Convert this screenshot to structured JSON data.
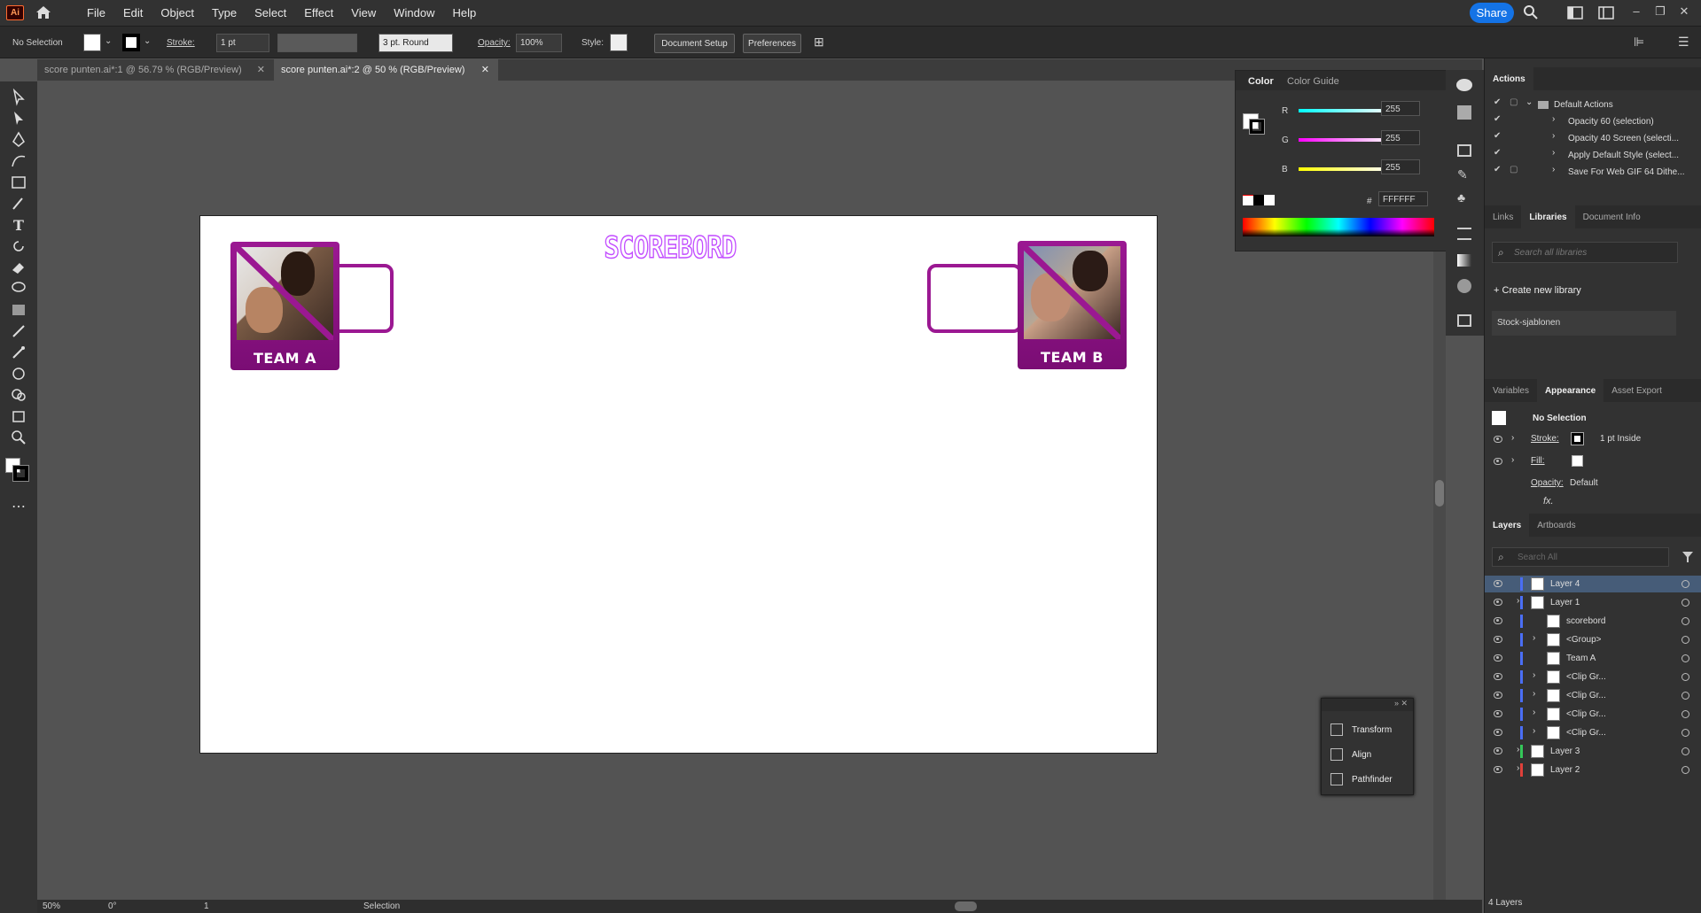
{
  "app": {
    "logo": "Ai",
    "menus": [
      "File",
      "Edit",
      "Object",
      "Type",
      "Select",
      "Effect",
      "View",
      "Window",
      "Help"
    ],
    "share": "Share"
  },
  "control": {
    "selection": "No Selection",
    "stroke_label": "Stroke:",
    "stroke_value": "1 pt",
    "brush": "3 pt. Round",
    "opacity_label": "Opacity:",
    "opacity_value": "100%",
    "style_label": "Style:",
    "doc_setup": "Document Setup",
    "preferences": "Preferences"
  },
  "tabs": [
    {
      "label": "score punten.ai*:1 @ 56.79 % (RGB/Preview)"
    },
    {
      "label": "score punten.ai*:2 @ 50 % (RGB/Preview)"
    }
  ],
  "artboard": {
    "title": "SCOREBORD",
    "team_a": "TEAM A",
    "team_b": "TEAM B"
  },
  "color_panel": {
    "tabs": [
      "Color",
      "Color Guide"
    ],
    "r": "255",
    "g": "255",
    "b": "255",
    "hex": "FFFFFF",
    "r_label": "R",
    "g_label": "G",
    "b_label": "B",
    "hash": "#"
  },
  "actions": {
    "title": "Actions",
    "items": [
      "Default Actions",
      "Opacity 60 (selection)",
      "Opacity 40 Screen (selecti...",
      "Apply Default Style (select...",
      "Save For Web GIF 64 Dithe..."
    ]
  },
  "libraries": {
    "tabs": [
      "Links",
      "Libraries",
      "Document Info"
    ],
    "search_placeholder": "Search all libraries",
    "create": "Create new library",
    "item": "Stock-sjablonen"
  },
  "appearance": {
    "tabs": [
      "Variables",
      "Appearance",
      "Asset Export"
    ],
    "selection": "No Selection",
    "stroke_label": "Stroke:",
    "stroke_value": "1 pt  Inside",
    "fill_label": "Fill:",
    "opacity_label": "Opacity:",
    "opacity_value": "Default",
    "fx": "fx."
  },
  "layers": {
    "tabs": [
      "Layers",
      "Artboards"
    ],
    "search_placeholder": "Search All",
    "footer": "4 Layers",
    "rows": [
      {
        "name": "Layer 4",
        "indent": 0,
        "expand": false,
        "color": "#4a6ef5",
        "selected": true
      },
      {
        "name": "Layer 1",
        "indent": 0,
        "expand": true,
        "color": "#4a6ef5",
        "selected": false
      },
      {
        "name": "scorebord",
        "indent": 1,
        "expand": false,
        "color": "#4a6ef5",
        "selected": false
      },
      {
        "name": "<Group>",
        "indent": 1,
        "expand": true,
        "color": "#4a6ef5",
        "selected": false
      },
      {
        "name": "Team A",
        "indent": 1,
        "expand": false,
        "color": "#4a6ef5",
        "selected": false
      },
      {
        "name": "<Clip Gr...",
        "indent": 1,
        "expand": true,
        "color": "#4a6ef5",
        "selected": false
      },
      {
        "name": "<Clip Gr...",
        "indent": 1,
        "expand": true,
        "color": "#4a6ef5",
        "selected": false
      },
      {
        "name": "<Clip Gr...",
        "indent": 1,
        "expand": true,
        "color": "#4a6ef5",
        "selected": false
      },
      {
        "name": "<Clip Gr...",
        "indent": 1,
        "expand": true,
        "color": "#4a6ef5",
        "selected": false
      },
      {
        "name": "Layer 3",
        "indent": 0,
        "expand": true,
        "color": "#34c759",
        "selected": false
      },
      {
        "name": "Layer 2",
        "indent": 0,
        "expand": true,
        "color": "#e0403a",
        "selected": false
      }
    ]
  },
  "float_panel": {
    "items": [
      "Transform",
      "Align",
      "Pathfinder"
    ]
  },
  "status": {
    "zoom": "50%",
    "rotate": "0°",
    "page": "1",
    "tool": "Selection"
  }
}
